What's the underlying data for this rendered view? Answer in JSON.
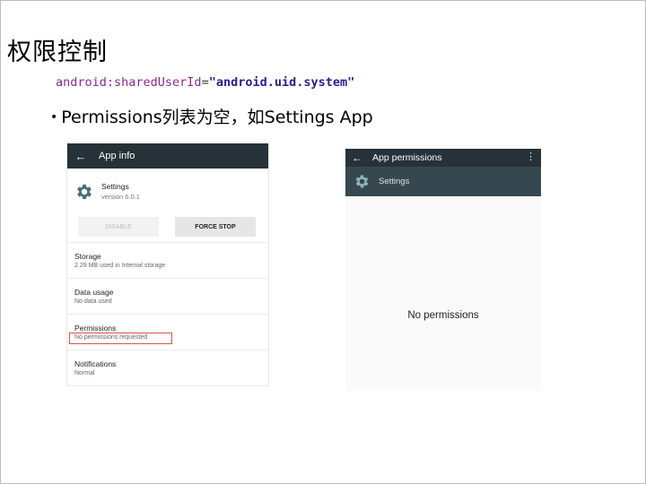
{
  "slide": {
    "title": "权限控制",
    "code": {
      "attr": "android:sharedUserId",
      "eq": "=",
      "value": "\"android.uid.system\""
    },
    "bullet": "Permissions列表为空，如Settings App"
  },
  "app_info": {
    "title": "App info",
    "app_name": "Settings",
    "version": "version 6.0.1",
    "disable_label": "DISABLE",
    "force_stop_label": "FORCE STOP",
    "sections": [
      {
        "heading": "Storage",
        "sub": "2.29 MB used in Internal storage"
      },
      {
        "heading": "Data usage",
        "sub": "No data used"
      },
      {
        "heading": "Permissions",
        "sub": "No permissions requested"
      },
      {
        "heading": "Notifications",
        "sub": "Normal"
      }
    ]
  },
  "app_permissions": {
    "title": "App permissions",
    "app_name": "Settings",
    "empty_text": "No permissions"
  },
  "icons": {
    "back": "arrow-back-icon",
    "settings": "gear-icon",
    "more": "more-vert-icon"
  },
  "colors": {
    "appbar": "#263238",
    "subbar": "#37474f",
    "gear": "#4a6f7a",
    "highlight_box": "#d9534f",
    "code_attr": "#8a2a8a",
    "code_value": "#2b1d8c"
  }
}
